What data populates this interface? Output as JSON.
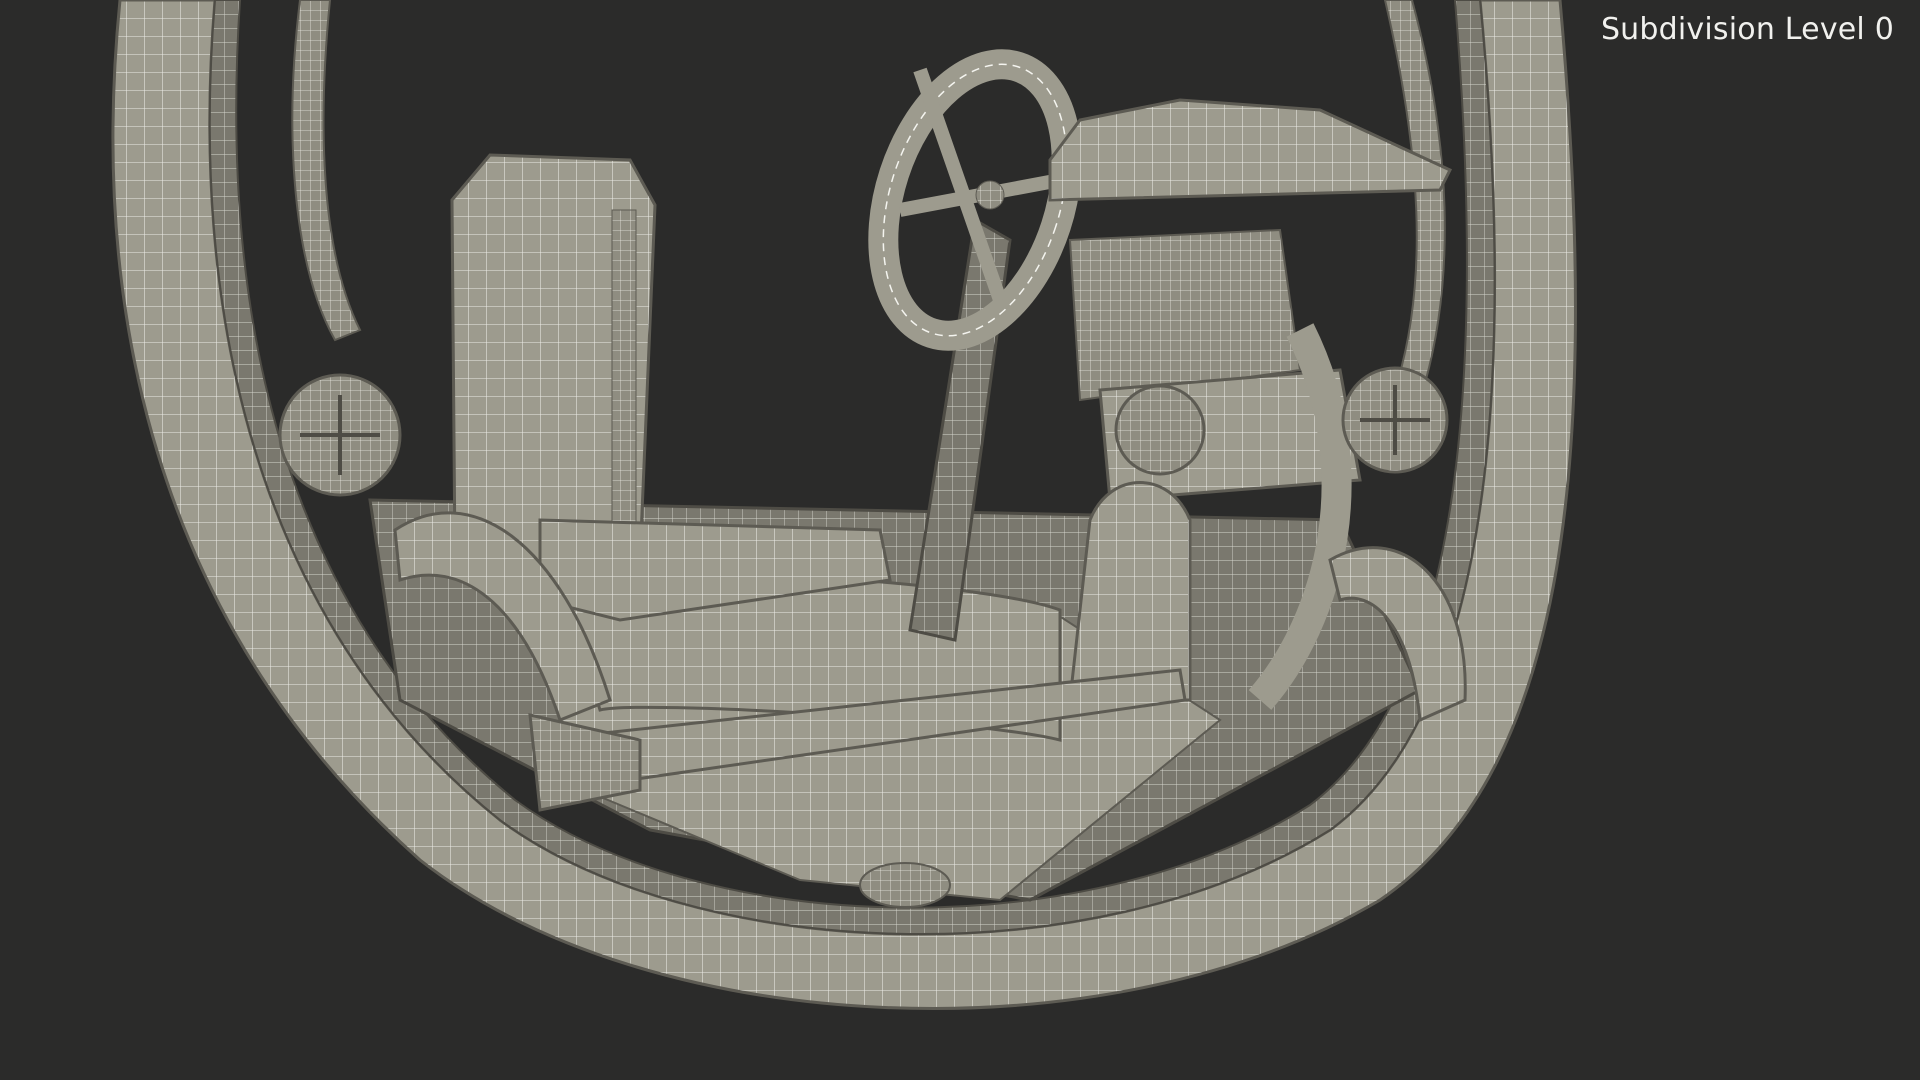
{
  "viewport": {
    "overlay_label": "Subdivision Level 0",
    "background_color": "#2b2b2a",
    "model_fill": "#9d9b8e",
    "model_shadow": "#6d6b62",
    "wire_color": "#f4f4ef",
    "subject": "monowheel-vehicle-wireframe"
  }
}
